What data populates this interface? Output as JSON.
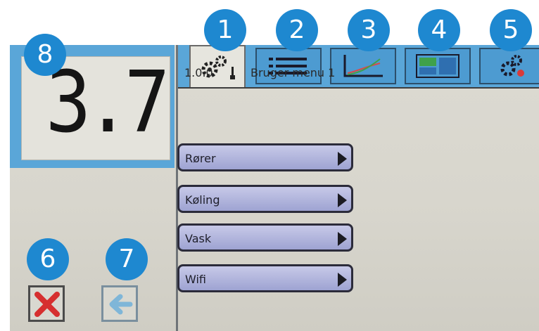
{
  "display": {
    "value": "3.7"
  },
  "tabs": [
    {
      "name": "settings",
      "icon": "gears-thermometer-icon"
    },
    {
      "name": "list",
      "icon": "list-icon"
    },
    {
      "name": "graph",
      "icon": "graph-icon"
    },
    {
      "name": "overview",
      "icon": "panels-icon"
    },
    {
      "name": "advanced",
      "icon": "gears-alert-icon"
    }
  ],
  "menu": {
    "code": "1.0.0",
    "title": "Bruger menu 1",
    "items": [
      {
        "label": "Rører"
      },
      {
        "label": "Køling"
      },
      {
        "label": "Vask"
      },
      {
        "label": "Wifi"
      }
    ]
  },
  "callouts": [
    "1",
    "2",
    "3",
    "4",
    "5",
    "6",
    "7",
    "8"
  ],
  "colors": {
    "accent": "#5aa6d8",
    "badge": "#1e88d0",
    "close": "#d62f2f",
    "back": "#7fb6d8"
  }
}
